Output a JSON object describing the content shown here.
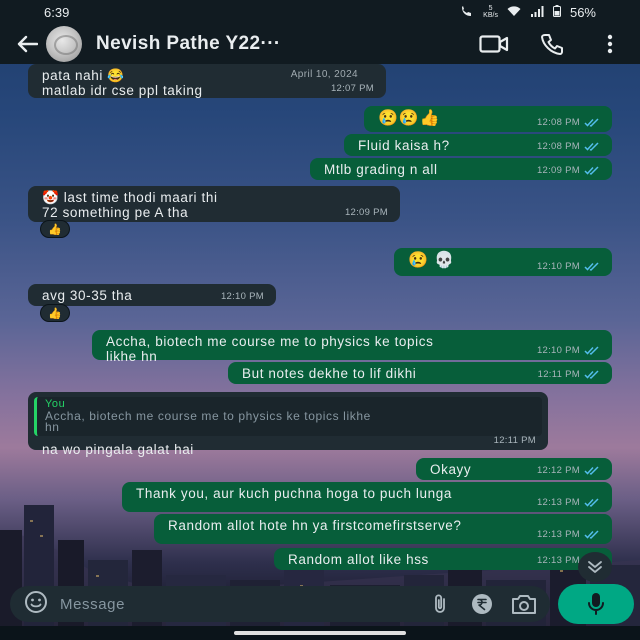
{
  "status": {
    "time": "6:39",
    "net_speed": "5",
    "net_unit": "KB/s",
    "battery": "56%"
  },
  "header": {
    "title": "Nevish Pathe Y22···"
  },
  "messages": [
    {
      "dir": "in",
      "lines": [
        "pata nahi 😂",
        "matlab idr cse ppl taking"
      ],
      "date": "April 10, 2024",
      "time": "12:07 PM"
    },
    {
      "dir": "out",
      "text": "😢😢👍",
      "time": "12:08 PM"
    },
    {
      "dir": "out",
      "text": "Fluid kaisa h?",
      "time": "12:08 PM"
    },
    {
      "dir": "out",
      "text": "Mtlb grading n all",
      "time": "12:09 PM"
    },
    {
      "dir": "in",
      "lines": [
        "🤡 last time thodi maari thi",
        "72 something pe A tha"
      ],
      "time": "12:09 PM",
      "reaction": "👍"
    },
    {
      "dir": "out",
      "text": "😢 💀",
      "time": "12:10 PM"
    },
    {
      "dir": "in",
      "text": "avg 30-35 tha",
      "time": "12:10 PM",
      "reaction": "👍"
    },
    {
      "dir": "out",
      "lines": [
        "Accha, biotech me course me to physics ke topics",
        "likhe hn"
      ],
      "time": "12:10 PM"
    },
    {
      "dir": "out",
      "text": "But notes dekhe to lif dikhi",
      "time": "12:11 PM"
    },
    {
      "dir": "in",
      "reply_who": "You",
      "reply_text": [
        "Accha, biotech me course me to physics ke topics likhe",
        "hn"
      ],
      "text": "na wo pingala galat hai",
      "time": "12:11 PM"
    },
    {
      "dir": "out",
      "text": "Okayy",
      "time": "12:12 PM"
    },
    {
      "dir": "out",
      "text": "Thank you, aur kuch puchna hoga to puch lunga",
      "time": "12:13 PM"
    },
    {
      "dir": "out",
      "text": "Random allot hote hn ya firstcomefirstserve?",
      "time": "12:13 PM"
    },
    {
      "dir": "out",
      "text": "Random allot like hss",
      "time": "12:13 PM"
    }
  ],
  "composer": {
    "placeholder": "Message"
  },
  "icons": {
    "back": "arrow-left-icon",
    "video": "video-call-icon",
    "call": "phone-icon",
    "menu": "more-vert-icon",
    "emoji": "emoji-icon",
    "attach": "attach-icon",
    "payment": "rupee-icon",
    "camera": "camera-icon",
    "mic": "mic-icon",
    "scroll": "chevron-down-icon"
  },
  "colors": {
    "incoming": "#202c33",
    "outgoing": "#075e3a",
    "accent": "#00a884",
    "read_ticks": "#53bdeb"
  }
}
